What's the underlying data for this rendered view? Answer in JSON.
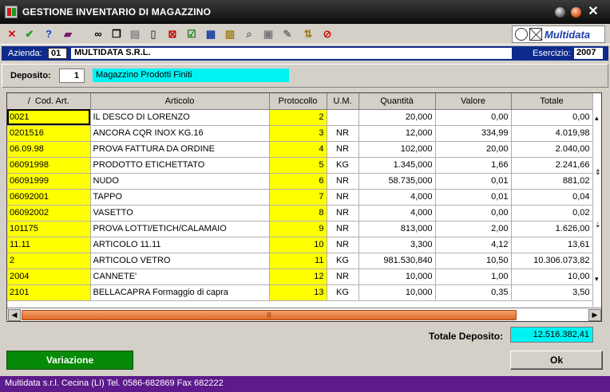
{
  "window": {
    "title": "GESTIONE INVENTARIO DI MAGAZZINO"
  },
  "toolbar": {
    "icons": [
      "cancel-icon",
      "confirm-icon",
      "help-icon",
      "book-icon",
      "binoculars-icon",
      "copy-icon",
      "paste-icon",
      "new-document-icon",
      "delete-document-icon",
      "checkbox-icon",
      "grid-icon",
      "edit-list-icon",
      "search-records-icon",
      "export-icon",
      "edit-icon",
      "sort-icon",
      "clear-icon"
    ],
    "brand": "Multidata"
  },
  "azienda": {
    "label": "Azienda:",
    "code": "01",
    "name": "MULTIDATA S.R.L.",
    "esercizio_label": "Esercizio:",
    "esercizio": "2007"
  },
  "deposito": {
    "label": "Deposito:",
    "number": "1",
    "name": "Magazzino Prodotti Finiti"
  },
  "grid": {
    "columns": [
      "Cod. Art.",
      "Articolo",
      "Protocollo",
      "U.M.",
      "Quantità",
      "Valore",
      "Totale"
    ],
    "sort_indicator": "/",
    "rows": [
      [
        "0021",
        "IL DESCO DI LORENZO",
        "2",
        "",
        "20,000",
        "0,00",
        "0,00"
      ],
      [
        "0201516",
        "ANCORA CQR INOX KG.16",
        "3",
        "NR",
        "12,000",
        "334,99",
        "4.019,98"
      ],
      [
        "06.09.98",
        "PROVA FATTURA DA ORDINE",
        "4",
        "NR",
        "102,000",
        "20,00",
        "2.040,00"
      ],
      [
        "06091998",
        "PRODOTTO ETICHETTATO",
        "5",
        "KG",
        "1.345,000",
        "1,66",
        "2.241,66"
      ],
      [
        "06091999",
        "NUDO",
        "6",
        "NR",
        "58.735,000",
        "0,01",
        "881,02"
      ],
      [
        "06092001",
        "TAPPO",
        "7",
        "NR",
        "4,000",
        "0,01",
        "0,04"
      ],
      [
        "06092002",
        "VASETTO",
        "8",
        "NR",
        "4,000",
        "0,00",
        "0,02"
      ],
      [
        "101175",
        "PROVA LOTTI/ETICH/CALAMAIO",
        "9",
        "NR",
        "813,000",
        "2,00",
        "1.626,00"
      ],
      [
        "11.11",
        "ARTICOLO 11.11",
        "10",
        "NR",
        "3,300",
        "4,12",
        "13,61"
      ],
      [
        "2",
        "ARTICOLO VETRO",
        "11",
        "KG",
        "981.530,840",
        "10,50",
        "10.306.073,82"
      ],
      [
        "2004",
        "CANNETE'",
        "12",
        "NR",
        "10,000",
        "1,00",
        "10,00"
      ],
      [
        "2101",
        "BELLACAPRA Formaggio di capra",
        "13",
        "KG",
        "10,000",
        "0,35",
        "3,50"
      ]
    ]
  },
  "totale": {
    "label": "Totale Deposito:",
    "value": "12.516.382,41"
  },
  "buttons": {
    "variazione": "Variazione",
    "ok": "Ok"
  },
  "status": "Multidata s.r.l. Cecina (LI) Tel. 0586-682869  Fax 682222",
  "colors": {
    "titlebar": "#0c0c0c",
    "azienda_bar": "#0d2a8c",
    "highlight_cyan": "#00f3f3",
    "key_yellow": "#ffff00",
    "variazione_green": "#078a07",
    "statusbar": "#5c1a8a"
  }
}
